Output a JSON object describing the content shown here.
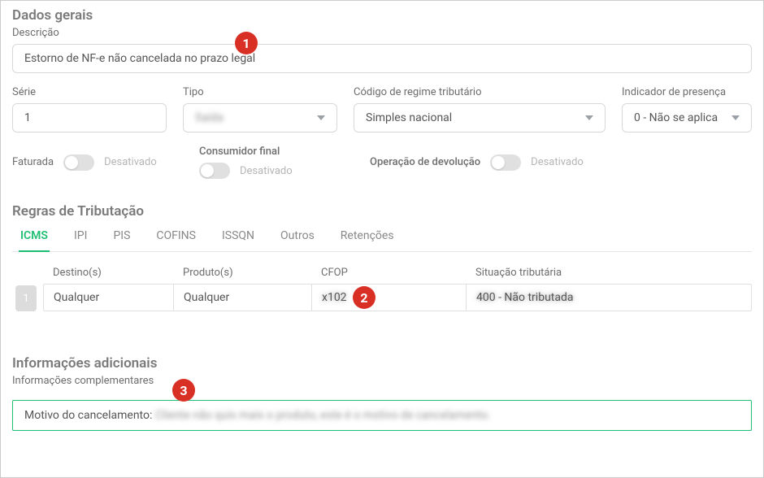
{
  "sections": {
    "general": {
      "title": "Dados gerais"
    },
    "tax_rules": {
      "title": "Regras de Tributação"
    },
    "additional": {
      "title": "Informações adicionais"
    }
  },
  "fields": {
    "descricao": {
      "label": "Descrição",
      "value": "Estorno de NF-e não cancelada no prazo legal"
    },
    "serie": {
      "label": "Série",
      "value": "1"
    },
    "tipo": {
      "label": "Tipo",
      "value": "Saída"
    },
    "regime": {
      "label": "Código de regime tributário",
      "value": "Simples nacional"
    },
    "presenca": {
      "label": "Indicador de presença",
      "value": "0 - Não se aplica"
    }
  },
  "toggles": {
    "faturada": {
      "label": "Faturada",
      "status": "Desativado"
    },
    "consumidor_final": {
      "label": "Consumidor final",
      "status": "Desativado"
    },
    "operacao_devolucao": {
      "label": "Operação de devolução",
      "status": "Desativado"
    }
  },
  "tabs": [
    "ICMS",
    "IPI",
    "PIS",
    "COFINS",
    "ISSQN",
    "Outros",
    "Retenções"
  ],
  "active_tab": 0,
  "rule_table": {
    "headers": {
      "destinos": "Destino(s)",
      "produtos": "Produto(s)",
      "cfop": "CFOP",
      "situacao": "Situação tributária"
    },
    "row_number": "1",
    "row": {
      "destinos": "Qualquer",
      "produtos": "Qualquer",
      "cfop": "x102",
      "situacao": "400 - Não tributada"
    }
  },
  "additional_info": {
    "label": "Informações complementares",
    "prefix": "Motivo do cancelamento: ",
    "text": "Cliente não quis mais o produto, este é o motivo de cancelamento."
  },
  "annotations": {
    "b1": "1",
    "b2": "2",
    "b3": "3"
  }
}
